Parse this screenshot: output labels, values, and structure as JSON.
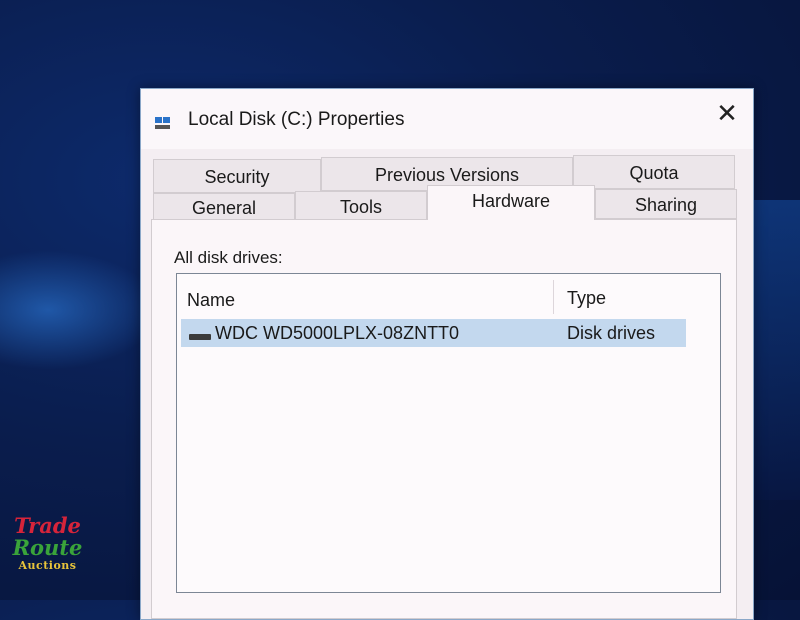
{
  "window": {
    "title": "Local Disk (C:) Properties",
    "close_label": "✕",
    "icon": "drive-window-icon"
  },
  "tabs": {
    "row1": [
      {
        "label": "Security"
      },
      {
        "label": "Previous Versions"
      },
      {
        "label": "Quota"
      }
    ],
    "row2": [
      {
        "label": "General"
      },
      {
        "label": "Tools"
      },
      {
        "label": "Hardware"
      },
      {
        "label": "Sharing"
      }
    ],
    "active": "Hardware"
  },
  "hardware": {
    "list_label": "All disk drives:",
    "columns": {
      "name": "Name",
      "type": "Type"
    },
    "rows": [
      {
        "name": "WDC WD5000LPLX-08ZNTT0",
        "type": "Disk drives",
        "icon": "disk-drive-icon",
        "selected": true
      }
    ]
  },
  "watermark": {
    "line1": "Trade",
    "line2": "Route",
    "line3": "Auctions"
  },
  "colors": {
    "selection": "#c3d8ee",
    "desktop": "#0a1d4d"
  }
}
